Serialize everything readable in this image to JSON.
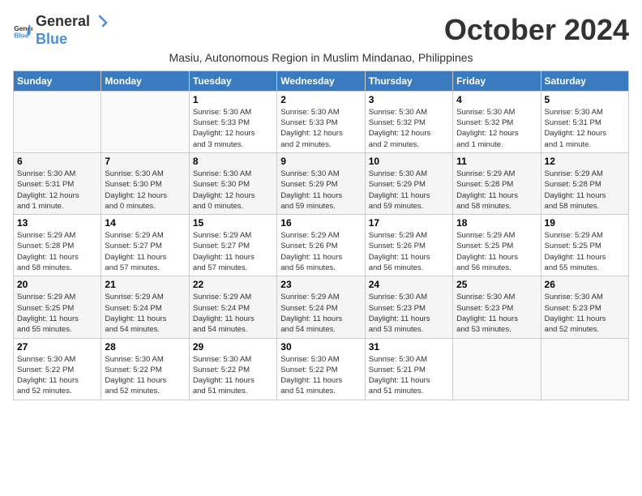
{
  "header": {
    "logo_general": "General",
    "logo_blue": "Blue",
    "month_title": "October 2024",
    "subtitle": "Masiu, Autonomous Region in Muslim Mindanao, Philippines"
  },
  "calendar": {
    "days_of_week": [
      "Sunday",
      "Monday",
      "Tuesday",
      "Wednesday",
      "Thursday",
      "Friday",
      "Saturday"
    ],
    "weeks": [
      [
        {
          "day": "",
          "info": ""
        },
        {
          "day": "",
          "info": ""
        },
        {
          "day": "1",
          "info": "Sunrise: 5:30 AM\nSunset: 5:33 PM\nDaylight: 12 hours\nand 3 minutes."
        },
        {
          "day": "2",
          "info": "Sunrise: 5:30 AM\nSunset: 5:33 PM\nDaylight: 12 hours\nand 2 minutes."
        },
        {
          "day": "3",
          "info": "Sunrise: 5:30 AM\nSunset: 5:32 PM\nDaylight: 12 hours\nand 2 minutes."
        },
        {
          "day": "4",
          "info": "Sunrise: 5:30 AM\nSunset: 5:32 PM\nDaylight: 12 hours\nand 1 minute."
        },
        {
          "day": "5",
          "info": "Sunrise: 5:30 AM\nSunset: 5:31 PM\nDaylight: 12 hours\nand 1 minute."
        }
      ],
      [
        {
          "day": "6",
          "info": "Sunrise: 5:30 AM\nSunset: 5:31 PM\nDaylight: 12 hours\nand 1 minute."
        },
        {
          "day": "7",
          "info": "Sunrise: 5:30 AM\nSunset: 5:30 PM\nDaylight: 12 hours\nand 0 minutes."
        },
        {
          "day": "8",
          "info": "Sunrise: 5:30 AM\nSunset: 5:30 PM\nDaylight: 12 hours\nand 0 minutes."
        },
        {
          "day": "9",
          "info": "Sunrise: 5:30 AM\nSunset: 5:29 PM\nDaylight: 11 hours\nand 59 minutes."
        },
        {
          "day": "10",
          "info": "Sunrise: 5:30 AM\nSunset: 5:29 PM\nDaylight: 11 hours\nand 59 minutes."
        },
        {
          "day": "11",
          "info": "Sunrise: 5:29 AM\nSunset: 5:28 PM\nDaylight: 11 hours\nand 58 minutes."
        },
        {
          "day": "12",
          "info": "Sunrise: 5:29 AM\nSunset: 5:28 PM\nDaylight: 11 hours\nand 58 minutes."
        }
      ],
      [
        {
          "day": "13",
          "info": "Sunrise: 5:29 AM\nSunset: 5:28 PM\nDaylight: 11 hours\nand 58 minutes."
        },
        {
          "day": "14",
          "info": "Sunrise: 5:29 AM\nSunset: 5:27 PM\nDaylight: 11 hours\nand 57 minutes."
        },
        {
          "day": "15",
          "info": "Sunrise: 5:29 AM\nSunset: 5:27 PM\nDaylight: 11 hours\nand 57 minutes."
        },
        {
          "day": "16",
          "info": "Sunrise: 5:29 AM\nSunset: 5:26 PM\nDaylight: 11 hours\nand 56 minutes."
        },
        {
          "day": "17",
          "info": "Sunrise: 5:29 AM\nSunset: 5:26 PM\nDaylight: 11 hours\nand 56 minutes."
        },
        {
          "day": "18",
          "info": "Sunrise: 5:29 AM\nSunset: 5:25 PM\nDaylight: 11 hours\nand 56 minutes."
        },
        {
          "day": "19",
          "info": "Sunrise: 5:29 AM\nSunset: 5:25 PM\nDaylight: 11 hours\nand 55 minutes."
        }
      ],
      [
        {
          "day": "20",
          "info": "Sunrise: 5:29 AM\nSunset: 5:25 PM\nDaylight: 11 hours\nand 55 minutes."
        },
        {
          "day": "21",
          "info": "Sunrise: 5:29 AM\nSunset: 5:24 PM\nDaylight: 11 hours\nand 54 minutes."
        },
        {
          "day": "22",
          "info": "Sunrise: 5:29 AM\nSunset: 5:24 PM\nDaylight: 11 hours\nand 54 minutes."
        },
        {
          "day": "23",
          "info": "Sunrise: 5:29 AM\nSunset: 5:24 PM\nDaylight: 11 hours\nand 54 minutes."
        },
        {
          "day": "24",
          "info": "Sunrise: 5:30 AM\nSunset: 5:23 PM\nDaylight: 11 hours\nand 53 minutes."
        },
        {
          "day": "25",
          "info": "Sunrise: 5:30 AM\nSunset: 5:23 PM\nDaylight: 11 hours\nand 53 minutes."
        },
        {
          "day": "26",
          "info": "Sunrise: 5:30 AM\nSunset: 5:23 PM\nDaylight: 11 hours\nand 52 minutes."
        }
      ],
      [
        {
          "day": "27",
          "info": "Sunrise: 5:30 AM\nSunset: 5:22 PM\nDaylight: 11 hours\nand 52 minutes."
        },
        {
          "day": "28",
          "info": "Sunrise: 5:30 AM\nSunset: 5:22 PM\nDaylight: 11 hours\nand 52 minutes."
        },
        {
          "day": "29",
          "info": "Sunrise: 5:30 AM\nSunset: 5:22 PM\nDaylight: 11 hours\nand 51 minutes."
        },
        {
          "day": "30",
          "info": "Sunrise: 5:30 AM\nSunset: 5:22 PM\nDaylight: 11 hours\nand 51 minutes."
        },
        {
          "day": "31",
          "info": "Sunrise: 5:30 AM\nSunset: 5:21 PM\nDaylight: 11 hours\nand 51 minutes."
        },
        {
          "day": "",
          "info": ""
        },
        {
          "day": "",
          "info": ""
        }
      ]
    ]
  }
}
